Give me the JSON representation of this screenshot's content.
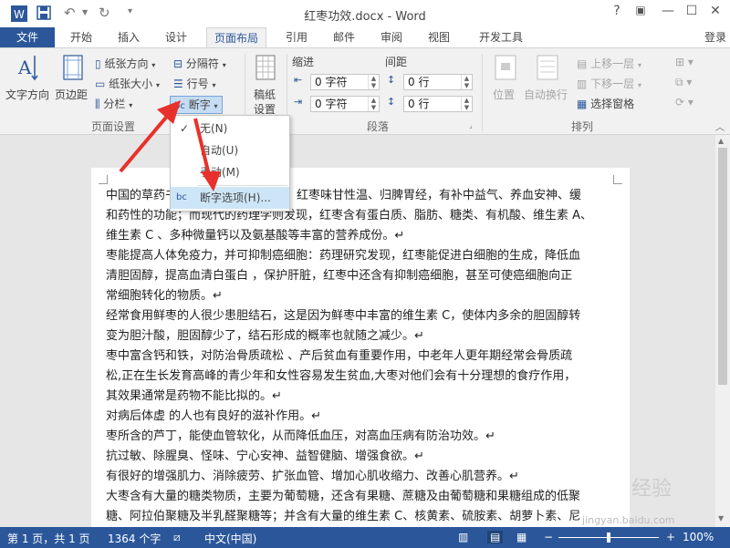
{
  "window": {
    "title": "红枣功效.docx - Word",
    "controls": [
      "?",
      "▣",
      "—",
      "☐",
      "✕"
    ]
  },
  "quick_access": {
    "app_icon": "word-icon",
    "save": "save-icon",
    "undo": "undo-icon",
    "redo": "redo-icon"
  },
  "tabs": [
    "文件",
    "开始",
    "插入",
    "设计",
    "页面布局",
    "引用",
    "邮件",
    "审阅",
    "视图",
    "开发工具"
  ],
  "active_tab": "页面布局",
  "login": "登录",
  "ribbon": {
    "page_setup": {
      "text_direction": "文字方向",
      "margins": "页边距",
      "orientation": "纸张方向",
      "size": "纸张大小",
      "columns": "分栏",
      "breaks": "分隔符",
      "line_numbers": "行号",
      "hyphenation": "断字",
      "label": "页面设置"
    },
    "manuscript": {
      "line1": "稿纸",
      "line2": "设置",
      "label": "稿纸"
    },
    "paragraph": {
      "indent_label": "缩进",
      "spacing_label": "间距",
      "indent_left": "0 字符",
      "indent_right": "0 字符",
      "spacing_before": "0 行",
      "spacing_after": "0 行",
      "label": "段落"
    },
    "arrange": {
      "position": "位置",
      "wrap": "自动换行",
      "bring_forward": "上移一层",
      "send_backward": "下移一层",
      "selection_pane": "选择窗格",
      "label": "排列"
    }
  },
  "hyphenation_menu": {
    "items": [
      {
        "label": "无(N)",
        "checked": true
      },
      {
        "label": "自动(U)",
        "checked": false
      },
      {
        "label": "手动(M)",
        "checked": false
      },
      {
        "label": "断字选项(H)...",
        "checked": false
      }
    ]
  },
  "document": {
    "paragraphs": [
      [
        "中国的草药书",
        "，红枣味甘性温、归脾胃经，有补中益气、养血安神、缓",
        "和药性的功能；而现代的药理学则发现，红枣含有蛋白质、脂肪、糖类、有机酸、维生素 A、",
        "维生素 C 、多种微量钙以及氨基酸等丰富的营养成份。↵"
      ],
      [
        "枣能提高人体免疫力，并可抑制癌细胞：药理研究发现，红枣能促进白细胞的生成，降低血",
        "清胆固醇，提高血清白蛋白 ，保护肝脏，红枣中还含有抑制癌细胞，甚至可使癌细胞向正",
        "常细胞转化的物质。↵"
      ],
      [
        "经常食用鲜枣的人很少患胆结石，这是因为鲜枣中丰富的维生素 C，使体内多余的胆固醇转",
        "变为胆汁酸，胆固醇少了，结石形成的概率也就随之减少。↵"
      ],
      [
        "枣中富含钙和铁，对防治骨质疏松 、产后贫血有重要作用，中老年人更年期经常会骨质疏",
        "松,正在生长发育高峰的青少年和女性容易发生贫血,大枣对他们会有十分理想的食疗作用，",
        "其效果通常是药物不能比拟的。↵"
      ],
      [
        "对病后体虚 的人也有良好的滋补作用。↵"
      ],
      [
        "枣所含的芦丁，能使血管软化，从而降低血压，对高血压病有防治功效。↵"
      ],
      [
        "抗过敏、除腥臭、怪味、宁心安神、益智健脑、增强食欲。↵"
      ],
      [
        "有很好的增强肌力、消除疲劳、扩张血管、增加心肌收缩力、改善心肌营养。↵"
      ],
      [
        "大枣含有大量的糖类物质，主要为葡萄糖，还含有果糖、蔗糖及由葡萄糖和果糖组成的低聚",
        "糖、阿拉伯聚糖及半乳醛聚糖等；并含有大量的维生素 C、核黄素、硫胺素、胡萝卜素、尼"
      ]
    ]
  },
  "status": {
    "page": "第 1 页，共 1 页",
    "words": "1364 个字",
    "language": "中文(中国)",
    "zoom_minus": "−",
    "zoom_plus": "+",
    "zoom": "100%"
  },
  "watermark": {
    "brand": "经验",
    "sub": "jingyan.baidu.com"
  },
  "colors": {
    "accent": "#2b579a",
    "arrow": "#e8312a"
  }
}
